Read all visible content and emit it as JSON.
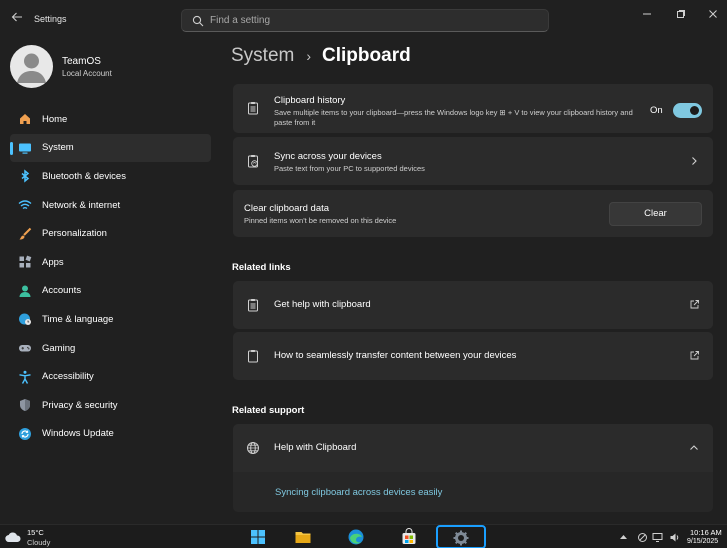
{
  "app": {
    "title": "Settings"
  },
  "search": {
    "placeholder": "Find a setting"
  },
  "profile": {
    "name": "TeamOS",
    "account_type": "Local Account"
  },
  "sidebar": {
    "items": [
      {
        "label": "Home",
        "icon": "home-icon"
      },
      {
        "label": "System",
        "icon": "system-icon",
        "active": true
      },
      {
        "label": "Bluetooth & devices",
        "icon": "bluetooth-icon"
      },
      {
        "label": "Network & internet",
        "icon": "wifi-icon"
      },
      {
        "label": "Personalization",
        "icon": "brush-icon"
      },
      {
        "label": "Apps",
        "icon": "apps-icon"
      },
      {
        "label": "Accounts",
        "icon": "accounts-icon"
      },
      {
        "label": "Time & language",
        "icon": "globe-clock-icon"
      },
      {
        "label": "Gaming",
        "icon": "gamepad-icon"
      },
      {
        "label": "Accessibility",
        "icon": "accessibility-icon"
      },
      {
        "label": "Privacy & security",
        "icon": "shield-icon"
      },
      {
        "label": "Windows Update",
        "icon": "update-icon"
      }
    ]
  },
  "breadcrumb": {
    "parent": "System",
    "separator": "›",
    "current": "Clipboard"
  },
  "settings": {
    "clipboard_history": {
      "title": "Clipboard history",
      "description": "Save multiple items to your clipboard—press the Windows logo key ⊞ + V to view your clipboard history and paste from it",
      "toggle_state": "On"
    },
    "sync": {
      "title": "Sync across your devices",
      "description": "Paste text from your PC to supported devices"
    },
    "clear": {
      "title": "Clear clipboard data",
      "description": "Pinned items won't be removed on this device",
      "button": "Clear"
    }
  },
  "related_links": {
    "heading": "Related links",
    "items": [
      {
        "label": "Get help with clipboard"
      },
      {
        "label": "How to seamlessly transfer content between your devices"
      }
    ]
  },
  "related_support": {
    "heading": "Related support",
    "title": "Help with Clipboard",
    "link": "Syncing clipboard across devices easily"
  },
  "taskbar": {
    "weather_temp": "15°C",
    "weather_condition": "Cloudy",
    "time": "10:16 AM",
    "date": "9/15/2025"
  },
  "colors": {
    "accent": "#4cc2ff",
    "toggle_on": "#7fc8e0",
    "background": "#202020",
    "card": "#2b2b2b"
  }
}
